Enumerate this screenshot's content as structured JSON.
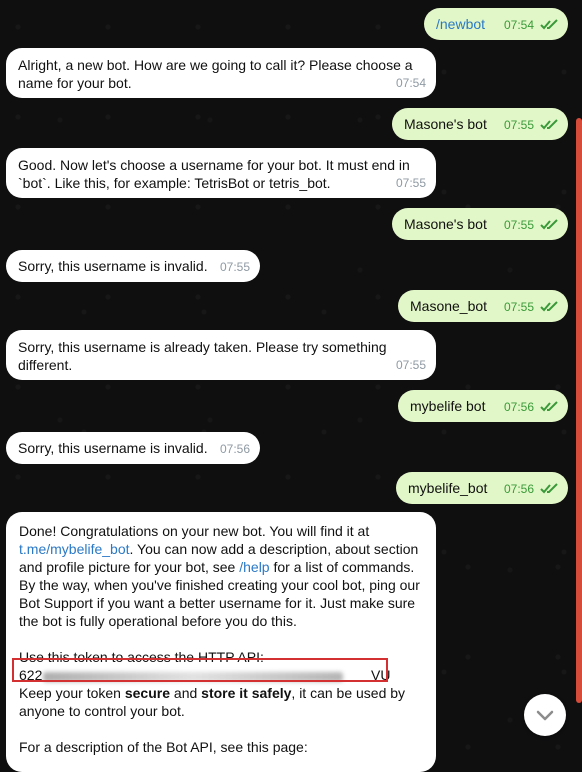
{
  "messages": [
    {
      "id": "m1",
      "side": "out",
      "text": "/newbot",
      "time": "07:54",
      "is_link": true
    },
    {
      "id": "m2",
      "side": "in",
      "text": "Alright, a new bot. How are we going to call it? Please choose a\nname for your bot.",
      "time": "07:54"
    },
    {
      "id": "m3",
      "side": "out",
      "text": "Masone's bot",
      "time": "07:55"
    },
    {
      "id": "m4",
      "side": "in",
      "text": "Good. Now let's choose a username for your bot. It must end in\n`bot`. Like this, for example: TetrisBot or tetris_bot.",
      "time": "07:55"
    },
    {
      "id": "m5",
      "side": "out",
      "text": "Masone's bot",
      "time": "07:55"
    },
    {
      "id": "m6",
      "side": "in",
      "text": "Sorry, this username is invalid.",
      "time": "07:55"
    },
    {
      "id": "m7",
      "side": "out",
      "text": "Masone_bot",
      "time": "07:55"
    },
    {
      "id": "m8",
      "side": "in",
      "text": "Sorry, this username is already taken. Please try something\ndifferent.",
      "time": "07:55"
    },
    {
      "id": "m9",
      "side": "out",
      "text": "mybelife bot",
      "time": "07:56"
    },
    {
      "id": "m10",
      "side": "in",
      "text": "Sorry, this username is invalid.",
      "time": "07:56"
    },
    {
      "id": "m11",
      "side": "out",
      "text": "mybelife_bot",
      "time": "07:56"
    },
    {
      "id": "m12",
      "side": "in",
      "lines": {
        "l1": "Done! Congratulations on your new bot. You will find it at",
        "link1": "t.me/mybelife_bot",
        "l2_rest": ". You can now add a description, about section",
        "l3a": "and profile picture for your bot, see ",
        "link2": "/help",
        "l3b": " for a list of commands.",
        "l4": "By the way, when you've finished creating your cool bot, ping our",
        "l5": "Bot Support if you want a better username for it. Just make sure",
        "l6": "the bot is fully operational before you do this.",
        "l7": "Use this token to access the HTTP API:",
        "token_prefix": "622",
        "token_suffix": "VU",
        "l9a": "Keep your token ",
        "l9b": "secure",
        "l9c": " and ",
        "l9d": "store it safely",
        "l9e": ", it can be used by",
        "l10": "anyone to control your bot.",
        "l11": "For a description of the Bot API, see this page:"
      }
    }
  ],
  "colors": {
    "outgoing_bubble": "#e2f7c7",
    "incoming_bubble": "#ffffff",
    "check": "#3a9a3a",
    "link": "#2a79c6",
    "highlight": "#d33131"
  },
  "icons": {
    "double_check": "double-check-icon",
    "scroll_down": "chevron-down-icon"
  }
}
